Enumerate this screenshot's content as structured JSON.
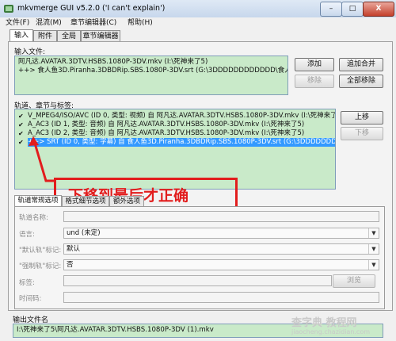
{
  "window": {
    "title": "mkvmerge GUI v5.2.0 ('I can't explain')",
    "controls": {
      "minimize": "–",
      "maximize": "□",
      "close": "X"
    }
  },
  "menu": [
    "文件(F)",
    "混流(M)",
    "章节编辑器(C)",
    "帮助(H)"
  ],
  "tabs": [
    "输入",
    "附件",
    "全局",
    "章节编辑器"
  ],
  "input_files": {
    "label": "输入文件:",
    "files": [
      "阿凡达.AVATAR.3DTV.HSBS.1080P-3DV.mkv (I:\\死神来了5)",
      "++> 食人鱼3D.Piranha.3DBDRip.SBS.1080P-3DV.srt (G:\\3DDDDDDDDDDDD\\食人鱼)"
    ],
    "buttons": {
      "add": "添加",
      "append": "追加合并",
      "remove": "移除",
      "remove_all": "全部移除"
    }
  },
  "tracks": {
    "label": "轨道、章节与标签:",
    "items": [
      {
        "check": "✔",
        "text": "V_MPEG4/ISO/AVC (ID 0, 类型: 视频) 自 阿凡达.AVATAR.3DTV.HSBS.1080P-3DV.mkv (I:\\死神来了",
        "selected": false
      },
      {
        "check": "✔",
        "text": "A_AC3 (ID 1, 类型: 音频) 自 阿凡达.AVATAR.3DTV.HSBS.1080P-3DV.mkv (I:\\死神来了5)",
        "selected": false
      },
      {
        "check": "✔",
        "text": "A_AC3 (ID 2, 类型: 音频) 自 阿凡达.AVATAR.3DTV.HSBS.1080P-3DV.mkv (I:\\死神来了5)",
        "selected": false
      },
      {
        "check": "✔",
        "text": "++> SRT (ID 0, 类型: 字幕) 自 食人鱼3D.Piranha.3DBDRip.SBS.1080P-3DV.srt (G:\\3DDDDDDDDDDD",
        "selected": true
      }
    ],
    "buttons": {
      "up": "上移",
      "down": "下移"
    }
  },
  "annotation": {
    "text": "下移到最后才正确"
  },
  "track_options": {
    "subtabs": [
      "轨道常规选项",
      "格式细节选项",
      "额外选项"
    ],
    "fields": {
      "name_label": "轨道名称:",
      "language_label": "语言:",
      "language_value": "und (未定)",
      "default_label": "\"默认轨\"标记:",
      "default_value": "默认",
      "forced_label": "\"强制轨\"标记:",
      "forced_value": "否",
      "tags_label": "标签:",
      "browse": "浏览",
      "timecodes_label": "时间码:"
    }
  },
  "output": {
    "label": "输出文件名",
    "value": "I:\\死神来了5\\阿凡达.AVATAR.3DTV.HSBS.1080P-3DV (1).mkv"
  },
  "watermark": {
    "main": "查字典 教程网",
    "url": "jiaocheng.chazidian.com"
  }
}
